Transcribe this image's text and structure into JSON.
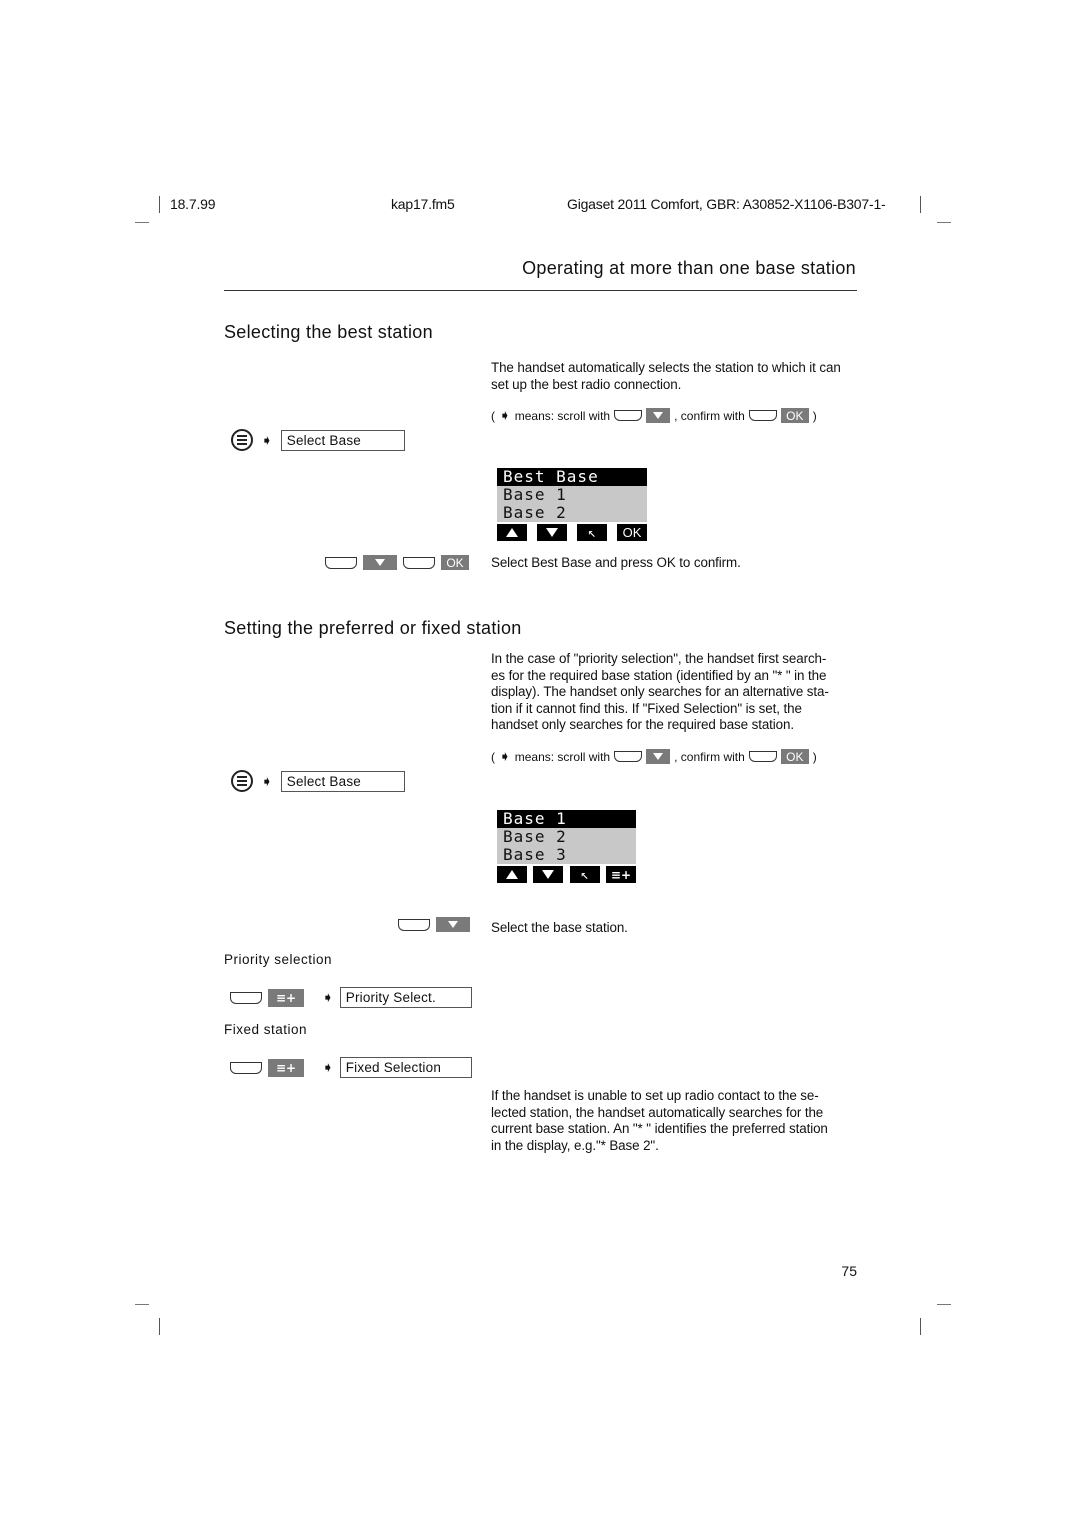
{
  "header": {
    "date": "18.7.99",
    "file": "kap17.fm5",
    "product": "Gigaset 2011 Comfort, GBR: A30852-X1106-B307-1-"
  },
  "chapter_title": "Operating at more than one base station",
  "section1": {
    "title": "Selecting the best station",
    "intro": "The handset automatically selects the station to which it can set up the best radio connection.",
    "hint": {
      "open_paren": "(",
      "arrow": "→",
      "means": "means: scroll with",
      "confirm": ", confirm with",
      "ok": "OK",
      "close_paren": ")"
    },
    "menu_icon": "menu-icon",
    "menu_item": "Select Base",
    "display": {
      "rows": [
        "Best  Base",
        "Base 1",
        "Base 2"
      ],
      "selected_index": 0,
      "softkeys": [
        "up",
        "down",
        "back",
        "OK"
      ]
    },
    "step_keys": [
      "softkey",
      "down",
      "softkey",
      "OK"
    ],
    "step_text": "Select Best Base and press OK to confirm."
  },
  "section2": {
    "title": "Setting the preferred or fixed station",
    "intro": "In the case of \"priority selection\", the handset first search-es for the required base station (identified by an \"* \" in the display). The handset only searches for an alternative sta-tion if it cannot find this. If \"Fixed Selection\" is set, the handset only searches for the required base station.",
    "intro_lines": [
      "In the case of \"priority selection\", the handset first search-",
      "es for the required base station (identified by an \"* \" in the",
      "display). The handset only searches for an alternative sta-",
      "tion if it cannot find this. If \"Fixed Selection\" is set, the",
      "handset only searches for the required base station."
    ],
    "hint": {
      "open_paren": "(",
      "arrow": "→",
      "means": "means: scroll with",
      "confirm": ", confirm with",
      "ok": "OK",
      "close_paren": ")"
    },
    "menu_item": "Select Base",
    "display": {
      "rows": [
        "Base 1",
        "Base 2",
        "Base 3"
      ],
      "selected_index": 0,
      "softkeys": [
        "up",
        "down",
        "back",
        "priority"
      ]
    },
    "step_text": "Select the base station.",
    "priority_label": "Priority selection",
    "priority_menu_item": "Priority Select.",
    "fixed_label": "Fixed station",
    "fixed_menu_item": "Fixed Selection",
    "outro_lines": [
      "If the handset is unable to set up radio contact to the se-",
      "lected station, the handset automatically searches for the",
      "current base station. An \"* \" identifies the preferred station",
      "in the display, e.g.\"* Base 2\"."
    ]
  },
  "page_number": "75"
}
